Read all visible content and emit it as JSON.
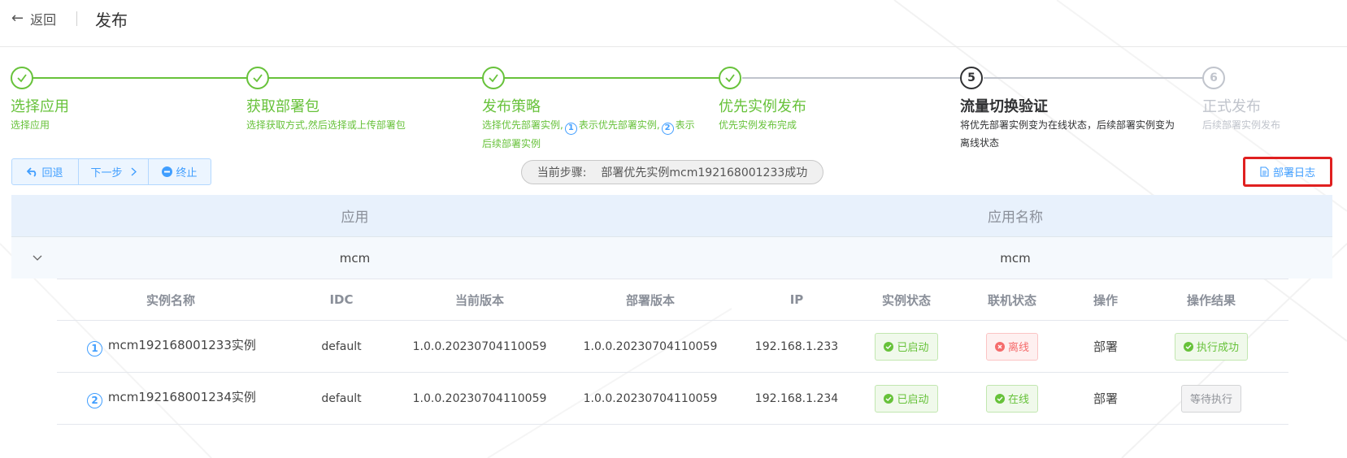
{
  "header": {
    "back_label": "返回",
    "title": "发布"
  },
  "steps": [
    {
      "title": "选择应用",
      "desc": "选择应用",
      "status": "done"
    },
    {
      "title": "获取部署包",
      "desc": "选择获取方式,然后选择或上传部署包",
      "status": "done"
    },
    {
      "title": "发布策略",
      "desc_a": "选择优先部署实例,",
      "badge1": "1",
      "desc_b": "表示优先部署实例,",
      "badge2": "2",
      "desc_c": "表示后续部署实例",
      "status": "done"
    },
    {
      "title": "优先实例发布",
      "desc": "优先实例发布完成",
      "status": "done"
    },
    {
      "number": "5",
      "title": "流量切换验证",
      "desc": "将优先部署实例变为在线状态，后续部署实例变为离线状态",
      "status": "current"
    },
    {
      "number": "6",
      "title": "正式发布",
      "desc": "后续部署实例发布",
      "status": "wait"
    }
  ],
  "toolbar": {
    "rollback_label": "回退",
    "next_label": "下一步",
    "stop_label": "终止",
    "current_step_label": "当前步骤:",
    "current_step_value": "部署优先实例mcm192168001233成功",
    "deploy_log_label": "部署日志"
  },
  "table": {
    "columns": [
      "应用",
      "应用名称"
    ],
    "rows": [
      {
        "app": "mcm",
        "app_name": "mcm"
      }
    ]
  },
  "instances": {
    "columns": [
      "实例名称",
      "IDC",
      "当前版本",
      "部署版本",
      "IP",
      "实例状态",
      "联机状态",
      "操作",
      "操作结果"
    ],
    "rows": [
      {
        "badge": "1",
        "name": "mcm192168001233实例",
        "idc": "default",
        "current_version": "1.0.0.20230704110059",
        "deploy_version": "1.0.0.20230704110059",
        "ip": "192.168.1.233",
        "instance_status": "已启动",
        "online_status": "离线",
        "action": "部署",
        "result": "执行成功"
      },
      {
        "badge": "2",
        "name": "mcm192168001234实例",
        "idc": "default",
        "current_version": "1.0.0.20230704110059",
        "deploy_version": "1.0.0.20230704110059",
        "ip": "192.168.1.234",
        "instance_status": "已启动",
        "online_status": "在线",
        "action": "部署",
        "result": "等待执行"
      }
    ]
  },
  "colors": {
    "success": "#67c23a",
    "primary": "#409eff",
    "danger": "#f56c6c",
    "highlight_border": "#e02020"
  }
}
